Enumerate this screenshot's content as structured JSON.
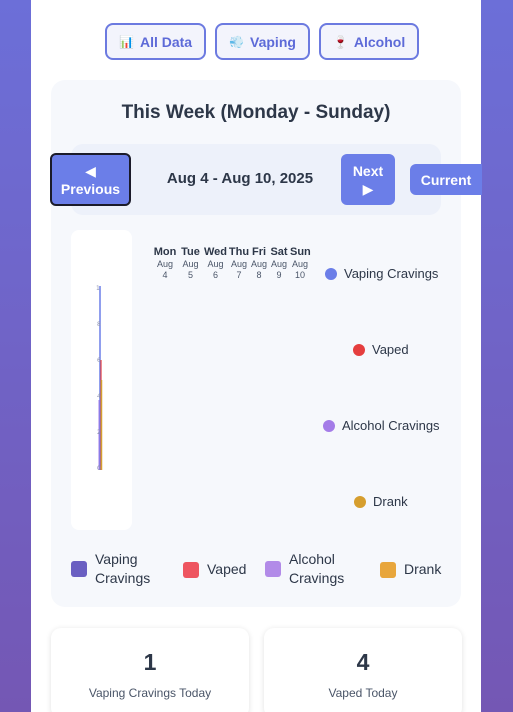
{
  "filters": [
    {
      "label": "All Data",
      "icon": "📊"
    },
    {
      "label": "Vaping",
      "icon": "💨"
    },
    {
      "label": "Alcohol",
      "icon": "🍷"
    }
  ],
  "week": {
    "title": "This Week (Monday - Sunday)",
    "range": "Aug 4 - Aug 10, 2025",
    "prev_arrow": "◀",
    "prev_label": "Previous",
    "next_label": "Next",
    "next_arrow": "▶",
    "current_label": "Current"
  },
  "days": [
    {
      "name": "Mon",
      "month": "Aug",
      "date": "4"
    },
    {
      "name": "Tue",
      "month": "Aug",
      "date": "5"
    },
    {
      "name": "Wed",
      "month": "Aug",
      "date": "6"
    },
    {
      "name": "Thu",
      "month": "Aug",
      "date": "7"
    },
    {
      "name": "Fri",
      "month": "Aug",
      "date": "8"
    },
    {
      "name": "Sat",
      "month": "Aug",
      "date": "9"
    },
    {
      "name": "Sun",
      "month": "Aug",
      "date": "10"
    }
  ],
  "chart_legend": [
    {
      "label": "Vaping Cravings",
      "color": "#6b7ee8"
    },
    {
      "label": "Vaped",
      "color": "#e53e3e"
    },
    {
      "label": "Alcohol Cravings",
      "color": "#a47ce8"
    },
    {
      "label": "Drank",
      "color": "#d69e2e"
    }
  ],
  "bottom_legend": [
    {
      "line1": "Vaping",
      "line2": "Cravings",
      "color": "#6a5fc2"
    },
    {
      "line1": "Vaped",
      "line2": "",
      "color": "#ee5560"
    },
    {
      "line1": "Alcohol",
      "line2": "Cravings",
      "color": "#b28be8"
    },
    {
      "line1": "Drank",
      "line2": "",
      "color": "#e8a63c"
    }
  ],
  "stats": [
    {
      "value": "1",
      "label": "Vaping Cravings Today"
    },
    {
      "value": "4",
      "label": "Vaped Today"
    }
  ]
}
